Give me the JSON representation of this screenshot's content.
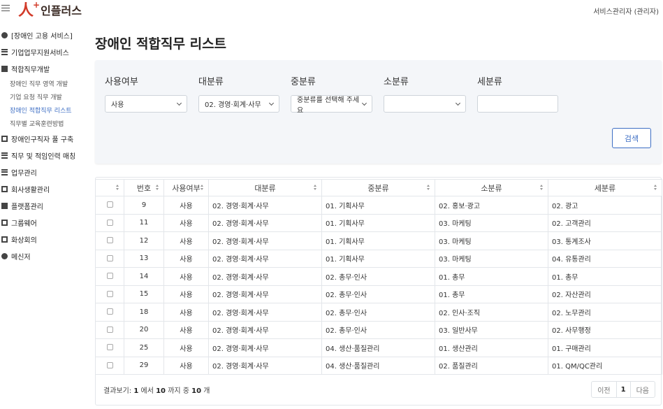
{
  "header": {
    "logo_s": "人",
    "logo_plus": "+",
    "logo_text": "인플러스",
    "user": "서비스관리자 (관리자)"
  },
  "sidebar": {
    "items": [
      {
        "label": "[장애인 고용 서비스]",
        "icon": "globe-icon"
      },
      {
        "label": "기업업무지원서비스",
        "icon": "handshake-icon"
      },
      {
        "label": "적합직무개발",
        "icon": "user-icon"
      }
    ],
    "subitems": [
      {
        "label": "장애인 직무 영역 개발"
      },
      {
        "label": "기업 요청 직무 개발"
      },
      {
        "label": "장애인 적합직무 리스트",
        "active": true
      },
      {
        "label": "직무별 교육훈련방법"
      }
    ],
    "items2": [
      {
        "label": "장애인구직자 풀 구축",
        "icon": "id-card-icon"
      },
      {
        "label": "직무 및 적임인력 매칭",
        "icon": "match-icon"
      },
      {
        "label": "업무관리",
        "icon": "list-icon"
      },
      {
        "label": "회사생활관리",
        "icon": "calendar-icon"
      },
      {
        "label": "플랫폼관리",
        "icon": "users-icon"
      },
      {
        "label": "그룹웨어",
        "icon": "document-icon"
      },
      {
        "label": "화상회의",
        "icon": "video-icon"
      },
      {
        "label": "메신저",
        "icon": "message-icon"
      }
    ]
  },
  "main": {
    "title": "장애인 적합직무 리스트"
  },
  "filters": {
    "usage_label": "사용여부",
    "usage_value": "사용",
    "major_label": "대분류",
    "major_value": "02. 경영·회계·사무",
    "middle_label": "중분류",
    "middle_value": "중분류를 선택해 주세요",
    "minor_label": "소분류",
    "minor_value": "",
    "detail_label": "세분류",
    "detail_value": "",
    "search_button": "검색"
  },
  "table": {
    "headers": [
      "",
      "번호",
      "사용여부",
      "대분류",
      "중분류",
      "소분류",
      "세분류"
    ],
    "rows": [
      [
        "9",
        "사용",
        "02. 경영·회계·사무",
        "01. 기획사무",
        "02. 홍보·광고",
        "02. 광고"
      ],
      [
        "11",
        "사용",
        "02. 경영·회계·사무",
        "01. 기획사무",
        "03. 마케팅",
        "02. 고객관리"
      ],
      [
        "12",
        "사용",
        "02. 경영·회계·사무",
        "01. 기획사무",
        "03. 마케팅",
        "03. 통계조사"
      ],
      [
        "13",
        "사용",
        "02. 경영·회계·사무",
        "01. 기획사무",
        "03. 마케팅",
        "04. 유통관리"
      ],
      [
        "14",
        "사용",
        "02. 경영·회계·사무",
        "02. 총무·인사",
        "01. 총무",
        "01. 총무"
      ],
      [
        "15",
        "사용",
        "02. 경영·회계·사무",
        "02. 총무·인사",
        "01. 총무",
        "02. 자산관리"
      ],
      [
        "18",
        "사용",
        "02. 경영·회계·사무",
        "02. 총무·인사",
        "02. 인사·조직",
        "02. 노무관리"
      ],
      [
        "20",
        "사용",
        "02. 경영·회계·사무",
        "02. 총무·인사",
        "03. 일반사무",
        "02. 사무행정"
      ],
      [
        "25",
        "사용",
        "02. 경영·회계·사무",
        "04. 생산·품질관리",
        "01. 생산관리",
        "01. 구매관리"
      ],
      [
        "29",
        "사용",
        "02. 경영·회계·사무",
        "04. 생산·품질관리",
        "02. 품질관리",
        "01. QM/QC관리"
      ]
    ]
  },
  "footer": {
    "prefix": "결과보기: ",
    "from": "1",
    "mid1": " 에서 ",
    "to": "10",
    "mid2": " 까지 중 ",
    "total": "10",
    "suffix": " 개"
  },
  "pagination": {
    "prev": "이전",
    "current": "1",
    "next": "다음"
  }
}
